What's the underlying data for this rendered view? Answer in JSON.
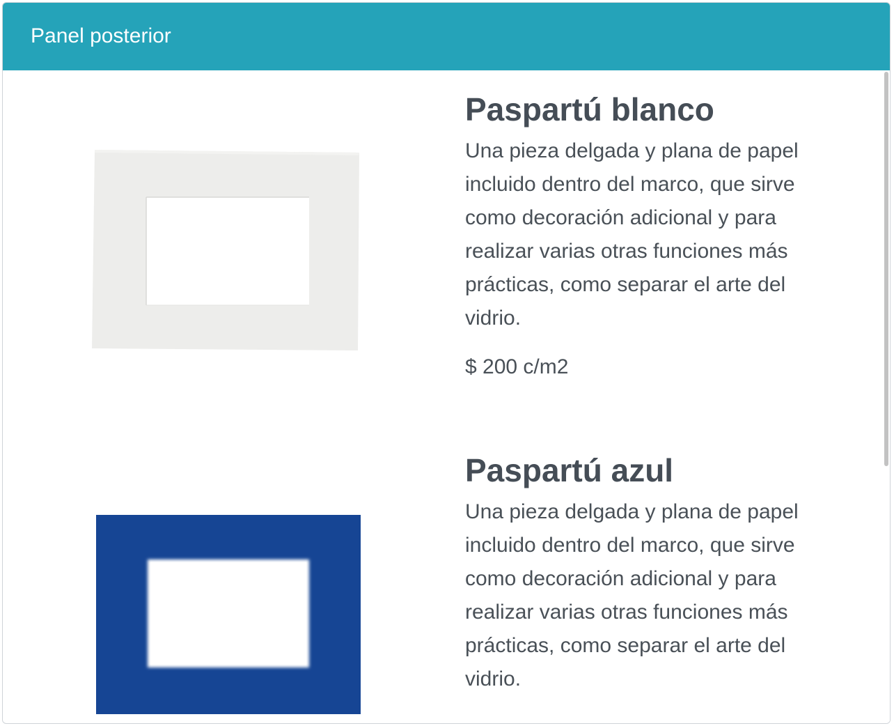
{
  "modal": {
    "title": "Panel posterior",
    "header_color": "#25a3b9"
  },
  "products": [
    {
      "image_icon": "white-mat-image",
      "mat_color": "#ededeb",
      "title": "Paspartú blanco",
      "description": "Una pieza delgada y plana de papel incluido dentro del marco, que sirve como decoración adicional y para realizar varias otras funciones más prácticas, como separar el arte del vidrio.",
      "price": "$ 200 c/m2"
    },
    {
      "image_icon": "blue-mat-image",
      "mat_color": "#164594",
      "title": "Paspartú azul",
      "description": "Una pieza delgada y plana de papel incluido dentro del marco, que sirve como decoración adicional y para realizar varias otras funciones más prácticas, como separar el arte del vidrio."
    }
  ]
}
